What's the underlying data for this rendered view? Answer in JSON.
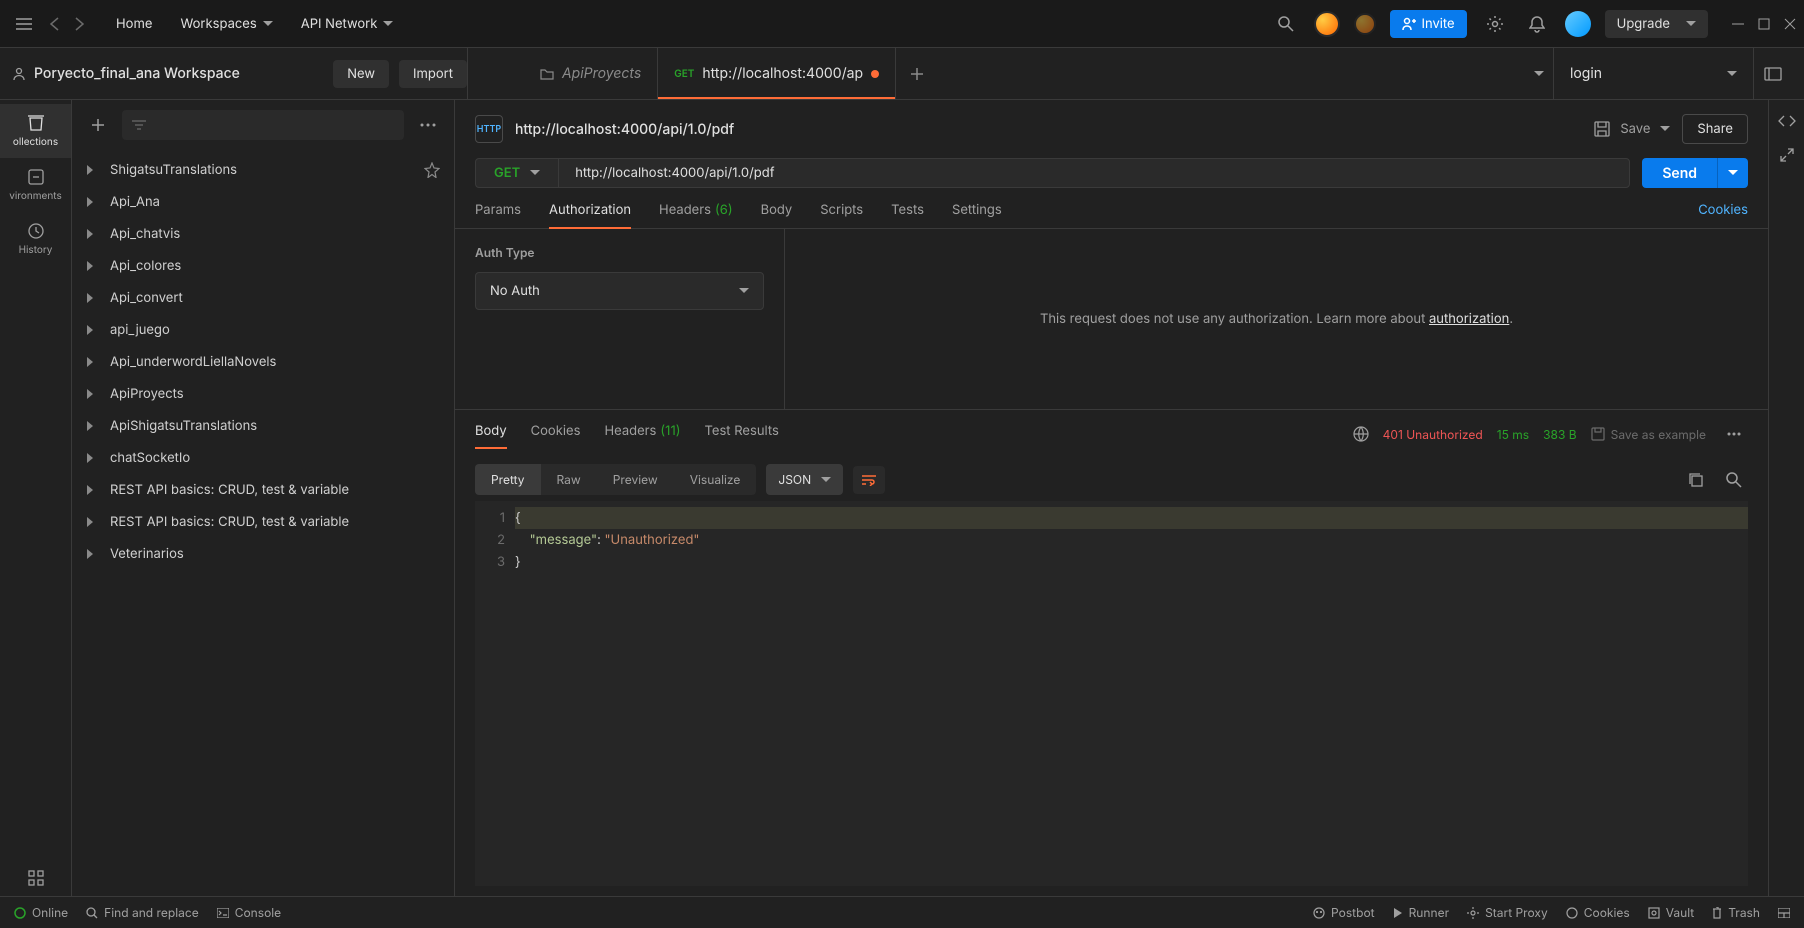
{
  "topbar": {
    "home": "Home",
    "workspaces": "Workspaces",
    "api_network": "API Network",
    "invite": "Invite",
    "upgrade": "Upgrade"
  },
  "workspace": {
    "name": "Poryecto_final_ana Workspace",
    "new": "New",
    "import": "Import"
  },
  "tabs": {
    "t1": "ApiProyects",
    "t2_method": "GET",
    "t2_name": "http://localhost:4000/ap",
    "env": "login"
  },
  "left_rail": {
    "collections": "ollections",
    "environments": "vironments",
    "history": "History"
  },
  "sidebar": {
    "items": [
      {
        "label": "ShigatsuTranslations",
        "starred": true
      },
      {
        "label": "Api_Ana"
      },
      {
        "label": "Api_chatvis"
      },
      {
        "label": "Api_colores"
      },
      {
        "label": "Api_convert"
      },
      {
        "label": "api_juego"
      },
      {
        "label": "Api_underwordLiellaNovels"
      },
      {
        "label": "ApiProyects"
      },
      {
        "label": "ApiShigatsuTranslations"
      },
      {
        "label": "chatSocketIo"
      },
      {
        "label": "REST API basics: CRUD, test & variable"
      },
      {
        "label": "REST API basics: CRUD, test & variable"
      },
      {
        "label": "Veterinarios"
      }
    ]
  },
  "request": {
    "title": "http://localhost:4000/api/1.0/pdf",
    "method": "GET",
    "url": "http://localhost:4000/api/1.0/pdf",
    "save": "Save",
    "share": "Share",
    "send": "Send"
  },
  "req_tabs": {
    "params": "Params",
    "auth": "Authorization",
    "headers": "Headers",
    "headers_count": "(6)",
    "body": "Body",
    "scripts": "Scripts",
    "tests": "Tests",
    "settings": "Settings",
    "cookies": "Cookies"
  },
  "auth": {
    "label": "Auth Type",
    "value": "No Auth",
    "info_pre": "This request does not use any authorization. Learn more about ",
    "info_link": "authorization",
    "info_post": "."
  },
  "response": {
    "body": "Body",
    "cookies": "Cookies",
    "headers": "Headers",
    "headers_count": "(11)",
    "tests": "Test Results",
    "status": "401 Unauthorized",
    "time": "15 ms",
    "size": "383 B",
    "save_example": "Save as example"
  },
  "resp_toolbar": {
    "pretty": "Pretty",
    "raw": "Raw",
    "preview": "Preview",
    "visualize": "Visualize",
    "format": "JSON"
  },
  "body_json": {
    "l1": "{",
    "l2_key": "\"message\"",
    "l2_colon": ": ",
    "l2_val": "\"Unauthorized\"",
    "l3": "}"
  },
  "footer": {
    "online": "Online",
    "find": "Find and replace",
    "console": "Console",
    "postbot": "Postbot",
    "runner": "Runner",
    "proxy": "Start Proxy",
    "cookies": "Cookies",
    "vault": "Vault",
    "trash": "Trash"
  }
}
